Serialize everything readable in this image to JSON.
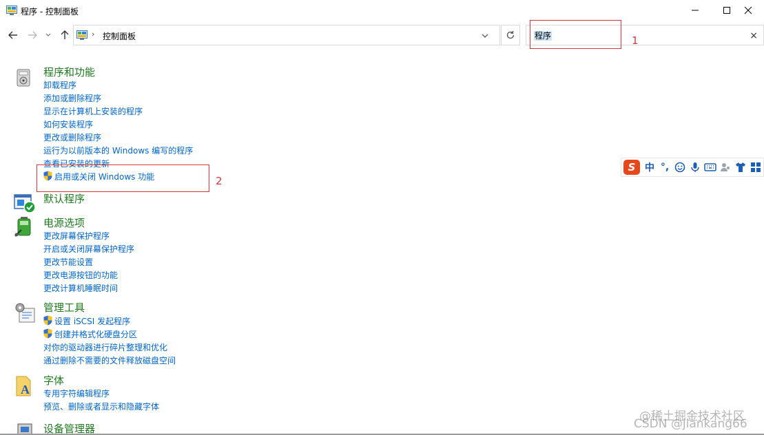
{
  "window": {
    "title": "程序 - 控制面板",
    "minimize_icon": "minimize-icon",
    "maximize_icon": "maximize-icon",
    "close_icon": "close-icon"
  },
  "nav": {
    "back_icon": "arrow-left-icon",
    "forward_icon": "arrow-right-icon",
    "recent_icon": "chevron-down-icon",
    "up_icon": "arrow-up-icon"
  },
  "address": {
    "separator": "›",
    "path": "控制面板"
  },
  "search": {
    "value": "程序",
    "clear": "×"
  },
  "categories": [
    {
      "title": "程序和功能",
      "icon": "programs-features-icon",
      "links": [
        "卸载程序",
        "添加或删除程序",
        "显示在计算机上安装的程序",
        "如何安装程序",
        "更改或删除程序",
        "运行为以前版本的 Windows 编写的程序",
        "查看已安装的更新",
        "启用或关闭 Windows 功能"
      ]
    },
    {
      "title": "默认程序",
      "icon": "default-programs-icon",
      "links": []
    },
    {
      "title": "电源选项",
      "icon": "power-options-icon",
      "links": [
        "更改屏幕保护程序",
        "开启或关闭屏幕保护程序",
        "更改节能设置",
        "更改电源按钮的功能",
        "更改计算机睡眠时间"
      ]
    },
    {
      "title": "管理工具",
      "icon": "admin-tools-icon",
      "links": [
        "设置 iSCSI 发起程序",
        "创建并格式化硬盘分区",
        "对你的驱动器进行碎片整理和优化",
        "通过删除不需要的文件释放磁盘空间"
      ]
    },
    {
      "title": "字体",
      "icon": "fonts-icon",
      "links": [
        "专用字符编辑程序",
        "预览、删除或者显示和隐藏字体"
      ]
    },
    {
      "title": "设备管理器",
      "icon": "device-manager-icon",
      "links": []
    }
  ],
  "annotations": [
    "1",
    "2"
  ],
  "ime": {
    "logo": "S",
    "mode": "中",
    "punct": "°,"
  },
  "watermarks": [
    "@稀土掘金技术社区",
    "CSDN @jiankang66"
  ],
  "colors": {
    "category_title": "#1e7a1e",
    "link": "#0066cc",
    "annotation": "#d9343a",
    "search_highlight": "#cce4f7"
  }
}
